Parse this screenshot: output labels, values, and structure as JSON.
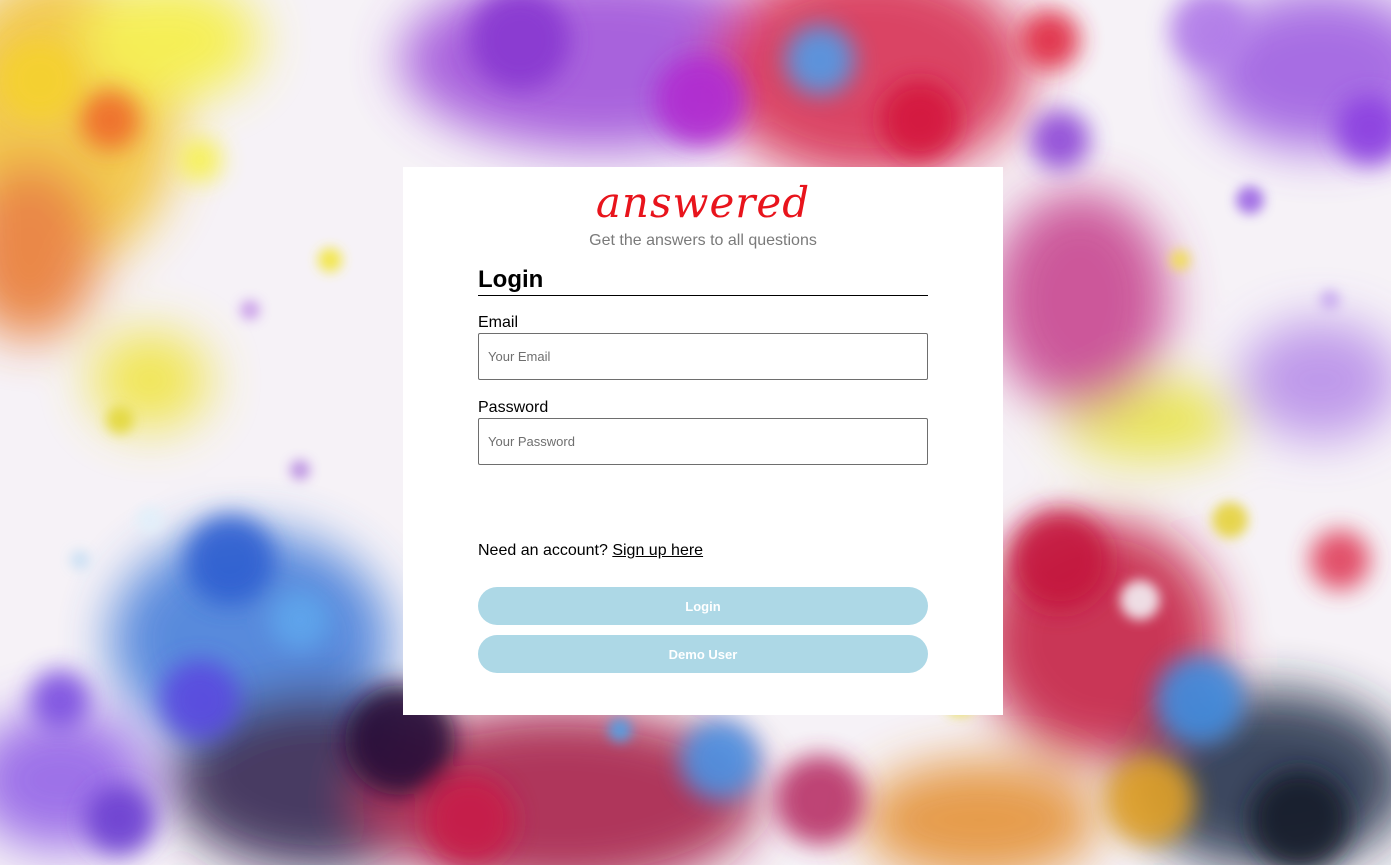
{
  "brand": {
    "logo_text": "answered",
    "tagline": "Get the answers to all questions",
    "logo_color": "#e8141c"
  },
  "login_form": {
    "heading": "Login",
    "email": {
      "label": "Email",
      "placeholder": "Your Email",
      "value": ""
    },
    "password": {
      "label": "Password",
      "placeholder": "Your Password",
      "value": ""
    },
    "signup_prompt": "Need an account?",
    "signup_link": "Sign up here",
    "login_button": "Login",
    "demo_button": "Demo User",
    "button_color": "#add8e6"
  }
}
